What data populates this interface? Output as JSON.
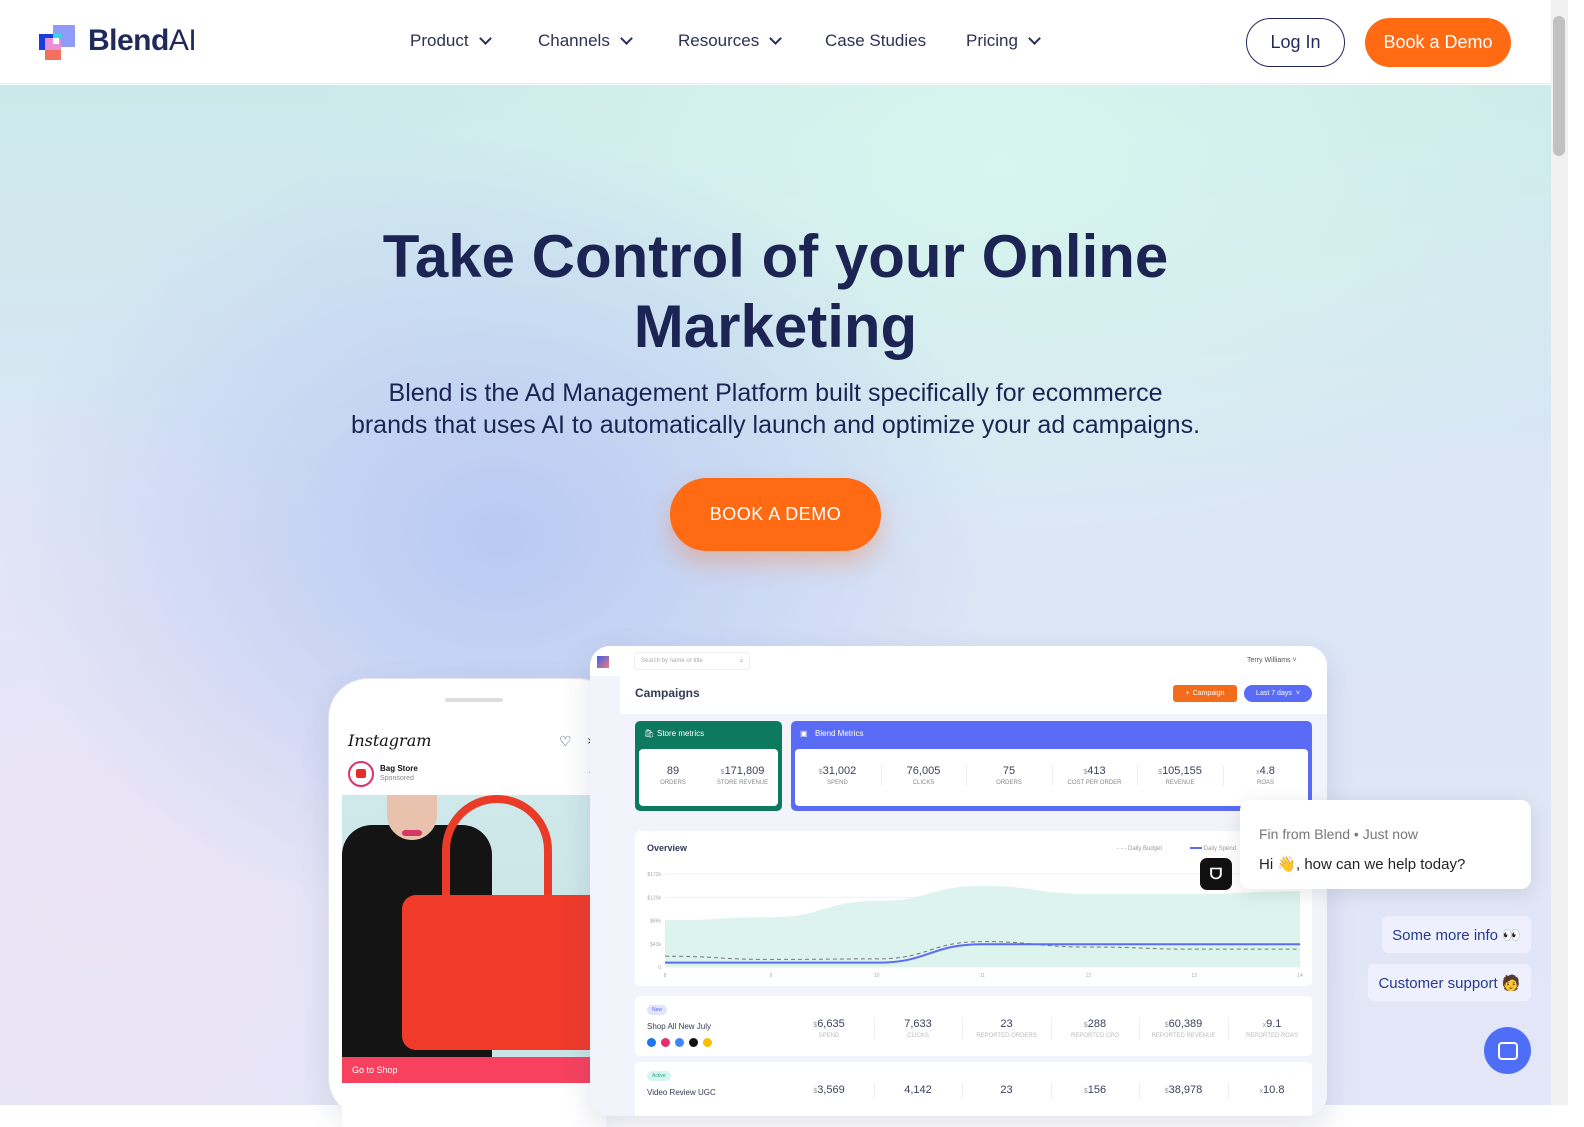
{
  "nav": {
    "brand": "Blend",
    "brand_suffix": "AI",
    "items": [
      {
        "label": "Product",
        "dropdown": true
      },
      {
        "label": "Channels",
        "dropdown": true
      },
      {
        "label": "Resources",
        "dropdown": true
      },
      {
        "label": "Case Studies",
        "dropdown": false
      },
      {
        "label": "Pricing",
        "dropdown": true
      }
    ],
    "login": "Log In",
    "book_demo": "Book a Demo"
  },
  "hero": {
    "title_line1": "Take Control of your Online",
    "title_line2": "Marketing",
    "subtitle_line1": "Blend is the Ad Management Platform built specifically for ecommerce",
    "subtitle_line2": "brands that uses AI to automatically launch and optimize your ad campaigns.",
    "cta": "BOOK A DEMO"
  },
  "colors": {
    "accent": "#ff6a13",
    "navy": "#1b2452",
    "blend_blue": "#5a6cf5",
    "store_green": "#0d7a5f",
    "instagram_cta": "#f7415f"
  },
  "phone": {
    "app": "Instagram",
    "account": "Bag Store",
    "sponsored": "Sponsored",
    "more": "...",
    "cta": "Go to Shop"
  },
  "dashboard": {
    "search_placeholder": "Search by name or title",
    "user": "Terry Williams",
    "page_title": "Campaigns",
    "add_campaign": "Campaign",
    "date_range": "Last 7 days",
    "store_metrics": {
      "title": "Store metrics",
      "items": [
        {
          "value": "89",
          "label": "ORDERS"
        },
        {
          "prefix": "$",
          "value": "171,809",
          "label": "STORE REVENUE"
        }
      ]
    },
    "blend_metrics": {
      "title": "Blend Metrics",
      "items": [
        {
          "prefix": "$",
          "value": "31,002",
          "label": "SPEND"
        },
        {
          "value": "76,005",
          "label": "CLICKS"
        },
        {
          "value": "75",
          "label": "ORDERS"
        },
        {
          "prefix": "$",
          "value": "413",
          "label": "COST PER ORDER"
        },
        {
          "prefix": "$",
          "value": "105,155",
          "label": "REVENUE"
        },
        {
          "prefix": "x",
          "value": "4.8",
          "label": "ROAS"
        }
      ]
    },
    "overview": {
      "title": "Overview",
      "chart_data": {
        "type": "line",
        "x": [
          8,
          9,
          10,
          11,
          12,
          13,
          14
        ],
        "yticks": [
          "0",
          "$43k",
          "$86k",
          "$129k",
          "$172k"
        ],
        "ylim": [
          0,
          172000
        ],
        "grid": true,
        "legend": "top-right",
        "series": [
          {
            "name": "Daily Budget",
            "style": "dashed",
            "values": [
              20000,
              14000,
              15000,
              47000,
              37000,
              33000,
              33000
            ]
          },
          {
            "name": "Daily Spend",
            "style": "solid",
            "values": [
              8000,
              8000,
              8000,
              42000,
              42000,
              42000,
              42000
            ]
          },
          {
            "style": "area",
            "values": [
              86000,
              92000,
              122000,
              150000,
              135000,
              135000,
              140000
            ]
          }
        ]
      }
    },
    "campaigns": [
      {
        "badge": "New",
        "name": "Shop All New July",
        "metrics": [
          {
            "prefix": "$",
            "value": "6,635",
            "label": "SPEND"
          },
          {
            "value": "7,633",
            "label": "CLICKS"
          },
          {
            "value": "23",
            "label": "REPORTED ORDERS"
          },
          {
            "prefix": "$",
            "value": "288",
            "label": "REPORTED CPO"
          },
          {
            "prefix": "$",
            "value": "60,389",
            "label": "REPORTED REVENUE"
          },
          {
            "prefix": "x",
            "value": "9.1",
            "label": "REPORTED ROAS"
          }
        ]
      },
      {
        "badge": "Active",
        "name": "Video Review UGC",
        "metrics": [
          {
            "prefix": "$",
            "value": "3,569"
          },
          {
            "value": "4,142"
          },
          {
            "value": "23"
          },
          {
            "prefix": "$",
            "value": "156"
          },
          {
            "prefix": "$",
            "value": "38,978"
          },
          {
            "prefix": "x",
            "value": "10.8"
          }
        ]
      }
    ]
  },
  "chat": {
    "sender": "Fin from Blend • Just now",
    "message": "Hi 👋, how can we help today?",
    "quick_replies": [
      "Some more info 👀",
      "Customer support 🧑"
    ]
  }
}
